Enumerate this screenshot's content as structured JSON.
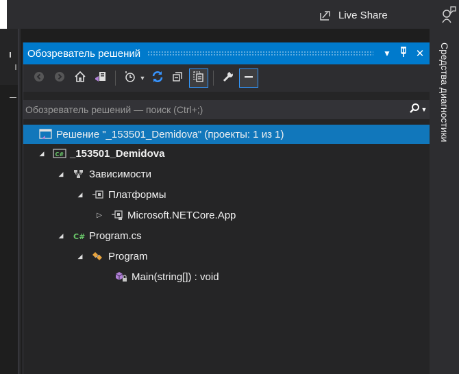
{
  "topbar": {
    "live_share_label": "Live Share"
  },
  "panel": {
    "title": "Обозреватель решений",
    "buttons": {
      "dropdown": "▼",
      "pin": "ᵖ",
      "close": "✕"
    },
    "search_placeholder": "Обозреватель решений — поиск (Ctrl+;)"
  },
  "toolbar": {
    "items": [
      "back-icon",
      "forward-icon",
      "home-icon",
      "switch-views-icon",
      "pending-changes-icon",
      "sync-icon",
      "collapse-all-icon",
      "show-all-files-icon",
      "properties-icon",
      "preview-icon"
    ]
  },
  "tree": {
    "solution": "Решение \"_153501_Demidova\" (проекты: 1 из 1)",
    "project": "_153501_Demidova",
    "dependencies": "Зависимости",
    "platforms": "Платформы",
    "netcore": "Microsoft.NETCore.App",
    "program_cs": "Program.cs",
    "program_class": "Program",
    "main_method": "Main(string[]) : void"
  },
  "right_tab": {
    "label": "Средства диагностики"
  },
  "colors": {
    "accent": "#007acc",
    "selection": "#1177bb",
    "panel_bg": "#252526",
    "toolbar_bg": "#2d2d30"
  }
}
